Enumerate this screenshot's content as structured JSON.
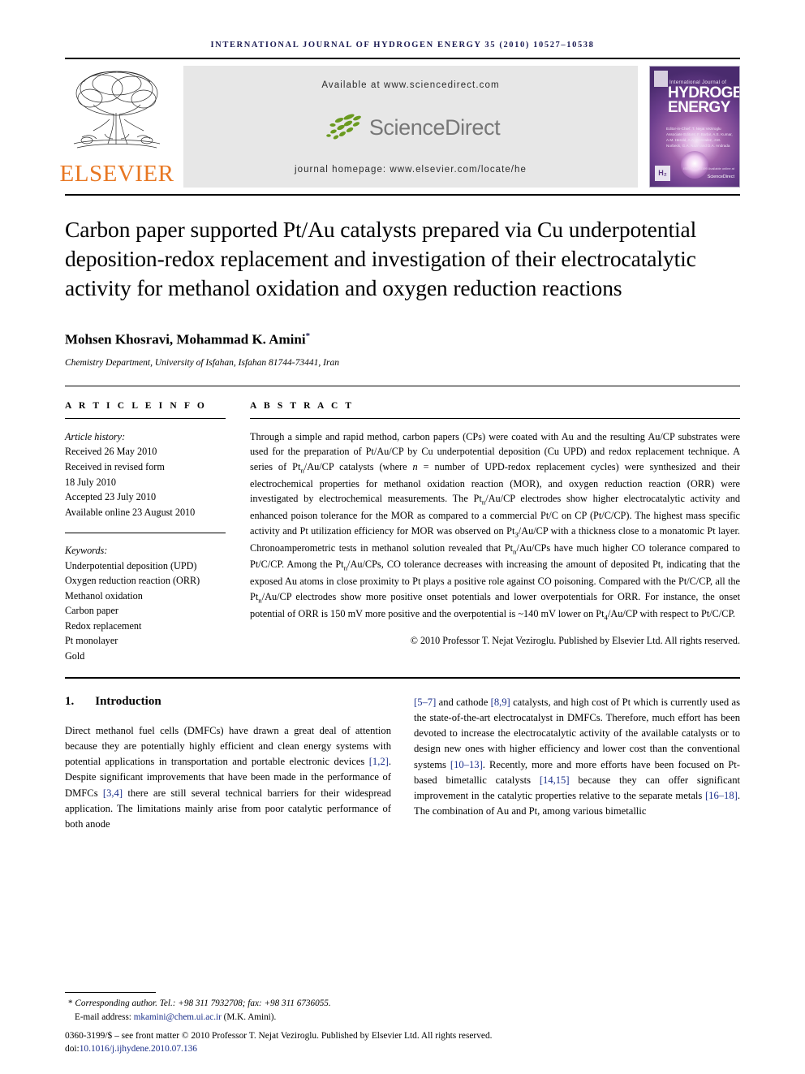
{
  "running_head": "INTERNATIONAL JOURNAL OF HYDROGEN ENERGY 35 (2010) 10527–10538",
  "masthead": {
    "publisher_name": "ELSEVIER",
    "available_at": "Available at www.sciencedirect.com",
    "sciencedirect_word": "ScienceDirect",
    "journal_homepage": "journal homepage: www.elsevier.com/locate/he",
    "cover": {
      "kicker": "International Journal of",
      "title_line1": "HYDROGEN",
      "title_line2": "ENERGY",
      "editors": "Editor-in-Chief: T. Nejat Veziroglu   Associate Editors: F. Barbir, A.S. Kumar, A.M. Herold, A.A. Gonzalez, J.M. Norbeck, G.A. Nazri and D.A. Andrada",
      "h2_badge": "H₂",
      "sciencedirect_badge": "ScienceDirect",
      "issn_note": "ISSN 0360-3199  Available online at"
    }
  },
  "article": {
    "title": "Carbon paper supported Pt/Au catalysts prepared via Cu underpotential deposition-redox replacement and investigation of their electrocatalytic activity for methanol oxidation and oxygen reduction reactions",
    "authors": "Mohsen Khosravi, Mohammad K. Amini",
    "author_marker": "*",
    "affiliation": "Chemistry Department, University of Isfahan, Isfahan 81744-73441, Iran"
  },
  "article_info": {
    "heading": "A R T I C L E   I N F O",
    "history_title": "Article history:",
    "history": [
      "Received 26 May 2010",
      "Received in revised form",
      "18 July 2010",
      "Accepted 23 July 2010",
      "Available online 23 August 2010"
    ],
    "keywords_title": "Keywords:",
    "keywords": [
      "Underpotential deposition (UPD)",
      "Oxygen reduction reaction (ORR)",
      "Methanol oxidation",
      "Carbon paper",
      "Redox replacement",
      "Pt monolayer",
      "Gold"
    ]
  },
  "abstract": {
    "heading": "A B S T R A C T",
    "copyright": "© 2010 Professor T. Nejat Veziroglu. Published by Elsevier Ltd. All rights reserved."
  },
  "introduction": {
    "number": "1.",
    "heading": "Introduction"
  },
  "footnotes": {
    "corresponding": "Corresponding author. Tel.: +98 311 7932708; fax: +98 311 6736055.",
    "email_label": "E-mail address:",
    "email": "mkamini@chem.ui.ac.ir",
    "email_owner": "(M.K. Amini).",
    "front_matter": "0360-3199/$ – see front matter © 2010 Professor T. Nejat Veziroglu. Published by Elsevier Ltd. All rights reserved.",
    "doi_label": "doi:",
    "doi": "10.1016/j.ijhydene.2010.07.136"
  },
  "colors": {
    "elsevier_orange": "#e87722",
    "link_blue": "#1b2f8a",
    "running_head_blue": "#1b1b52",
    "sciencedirect_green": "#6a9a1f",
    "banner_gray": "#e7e7e7"
  }
}
